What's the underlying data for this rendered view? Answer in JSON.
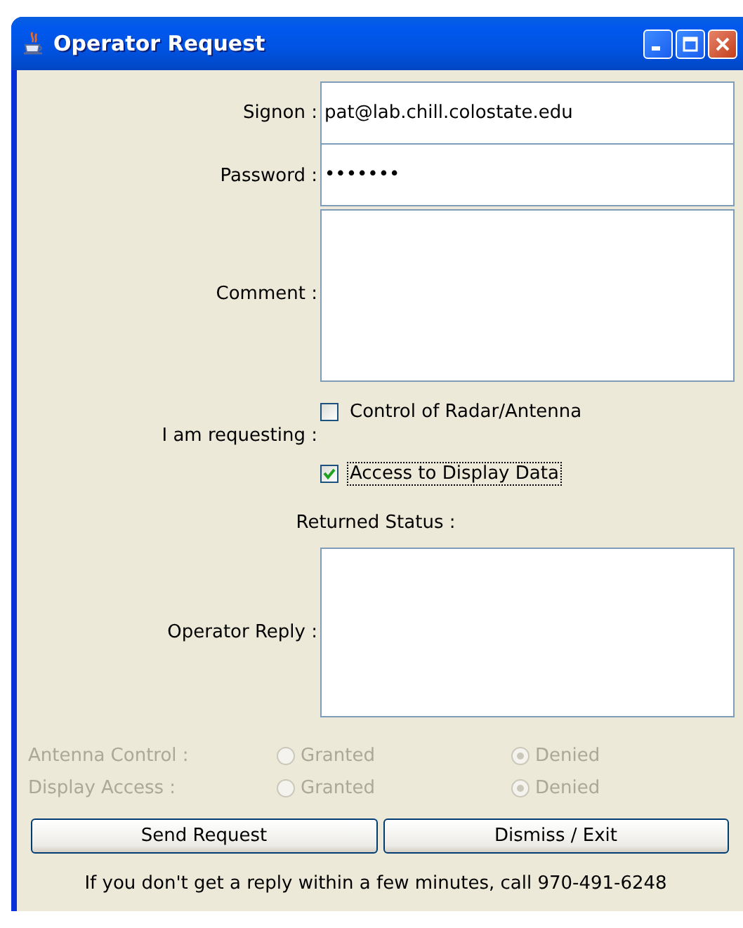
{
  "window": {
    "title": "Operator Request"
  },
  "form": {
    "signon": {
      "label": "Signon :",
      "value": "pat@lab.chill.colostate.edu"
    },
    "password": {
      "label": "Password :",
      "value": "•••••••"
    },
    "comment": {
      "label": "Comment :"
    }
  },
  "requesting": {
    "label": "I am requesting :",
    "options": [
      {
        "label": "Control of Radar/Antenna",
        "checked": false,
        "focused": false
      },
      {
        "label": "Access to Display Data",
        "checked": true,
        "focused": true
      }
    ]
  },
  "returned_status": {
    "heading": "Returned Status :",
    "reply_label": "Operator Reply :"
  },
  "status_rows": [
    {
      "label": "Antenna Control :",
      "disabled": true,
      "options": [
        {
          "label": "Granted",
          "selected": false
        },
        {
          "label": "Denied",
          "selected": true
        }
      ]
    },
    {
      "label": "Display Access :",
      "disabled": true,
      "options": [
        {
          "label": "Granted",
          "selected": false
        },
        {
          "label": "Denied",
          "selected": true
        }
      ]
    }
  ],
  "buttons": [
    {
      "label": "Send Request"
    },
    {
      "label": "Dismiss / Exit"
    }
  ],
  "footer": "If you don't get a reply within a few minutes, call 970-491-6248"
}
